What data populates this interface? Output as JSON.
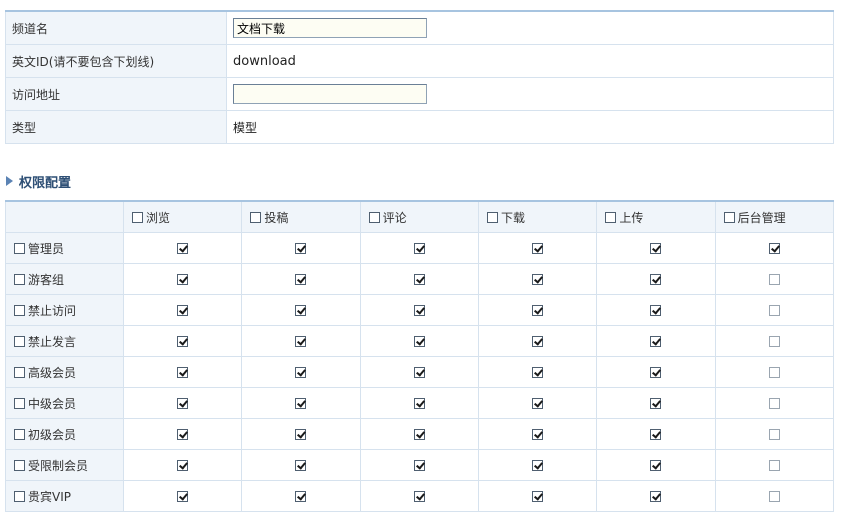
{
  "info": {
    "channel_name_label": "频道名",
    "channel_name_value": "文档下载",
    "english_id_label": "英文ID(请不要包含下划线)",
    "english_id_value": "download",
    "url_label": "访问地址",
    "url_value": "",
    "type_label": "类型",
    "type_value": "模型"
  },
  "section": {
    "title": "权限配置"
  },
  "columns": [
    "浏览",
    "投稿",
    "评论",
    "下载",
    "上传",
    "后台管理"
  ],
  "rows": [
    {
      "label": "管理员",
      "checks": [
        true,
        true,
        true,
        true,
        true,
        true
      ]
    },
    {
      "label": "游客组",
      "checks": [
        true,
        true,
        true,
        true,
        true,
        false
      ]
    },
    {
      "label": "禁止访问",
      "checks": [
        true,
        true,
        true,
        true,
        true,
        false
      ]
    },
    {
      "label": "禁止发言",
      "checks": [
        true,
        true,
        true,
        true,
        true,
        false
      ]
    },
    {
      "label": "高级会员",
      "checks": [
        true,
        true,
        true,
        true,
        true,
        false
      ]
    },
    {
      "label": "中级会员",
      "checks": [
        true,
        true,
        true,
        true,
        true,
        false
      ]
    },
    {
      "label": "初级会员",
      "checks": [
        true,
        true,
        true,
        true,
        true,
        false
      ]
    },
    {
      "label": "受限制会员",
      "checks": [
        true,
        true,
        true,
        true,
        true,
        false
      ]
    },
    {
      "label": "贵宾VIP",
      "checks": [
        true,
        true,
        true,
        true,
        true,
        false
      ]
    }
  ]
}
